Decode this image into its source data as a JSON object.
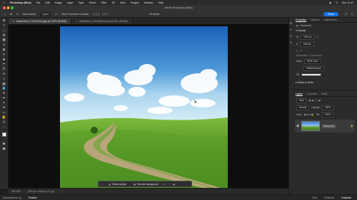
{
  "menubar": {
    "items": [
      "Photoshop (Beta)",
      "File",
      "Edit",
      "Image",
      "Layer",
      "Type",
      "Select",
      "Filter",
      "3D",
      "View",
      "Plugins",
      "Window",
      "Help"
    ],
    "clock": "Sun 11:47"
  },
  "window": {
    "title": "Adobe Photoshop (Beta)"
  },
  "options": {
    "auto_select_label": "Auto-Select:",
    "auto_select_value": "Layer",
    "transform_label": "Show Transform Controls",
    "share_label": "Share"
  },
  "tabs": [
    {
      "label": "AdobeStock_215042316.jpeg @ 100% (RGB/8)",
      "active": true
    },
    {
      "label": "AdobeStock_354560515.jpeg @ 96% (RGB/8)",
      "active": false
    }
  ],
  "taskbar": {
    "select_subject": "Select subject",
    "remove_background": "Remove background"
  },
  "status": {
    "zoom": "100.00%",
    "dimensions": "1000 px x 1000 px (72 ppi)"
  },
  "bottom_tabs": [
    "Measurement Log",
    "Timeline"
  ],
  "properties": {
    "tabs": [
      "Properties",
      "Libraries",
      "Adjustments"
    ],
    "doc_label": "Document",
    "canvas_heading": "Canvas",
    "width": "1000 px",
    "height": "1000 px",
    "resolution": "Resolution: 72 pixels/inch",
    "mode_label": "Mode",
    "mode_value": "RGB Color",
    "bits_value": "8 Bits/Channel",
    "fill_label": "Fill",
    "rulers_heading": "Rulers & Grids"
  },
  "layers": {
    "tabs": [
      "Layers",
      "Channels",
      "Paths"
    ],
    "filter_label": "Kind",
    "blend_mode": "Normal",
    "opacity_label": "Opacity:",
    "opacity_value": "100%",
    "lock_label": "Lock:",
    "fill_label": "Fill:",
    "fill_value": "100%",
    "layer_name": "Background"
  },
  "right_bottom_tabs": [
    "Color",
    "Swatches",
    "Gradients"
  ],
  "colors": {
    "accent": "#1473e6",
    "foreground_swatch": "#ffffff",
    "background_swatch": "#c8220e"
  }
}
